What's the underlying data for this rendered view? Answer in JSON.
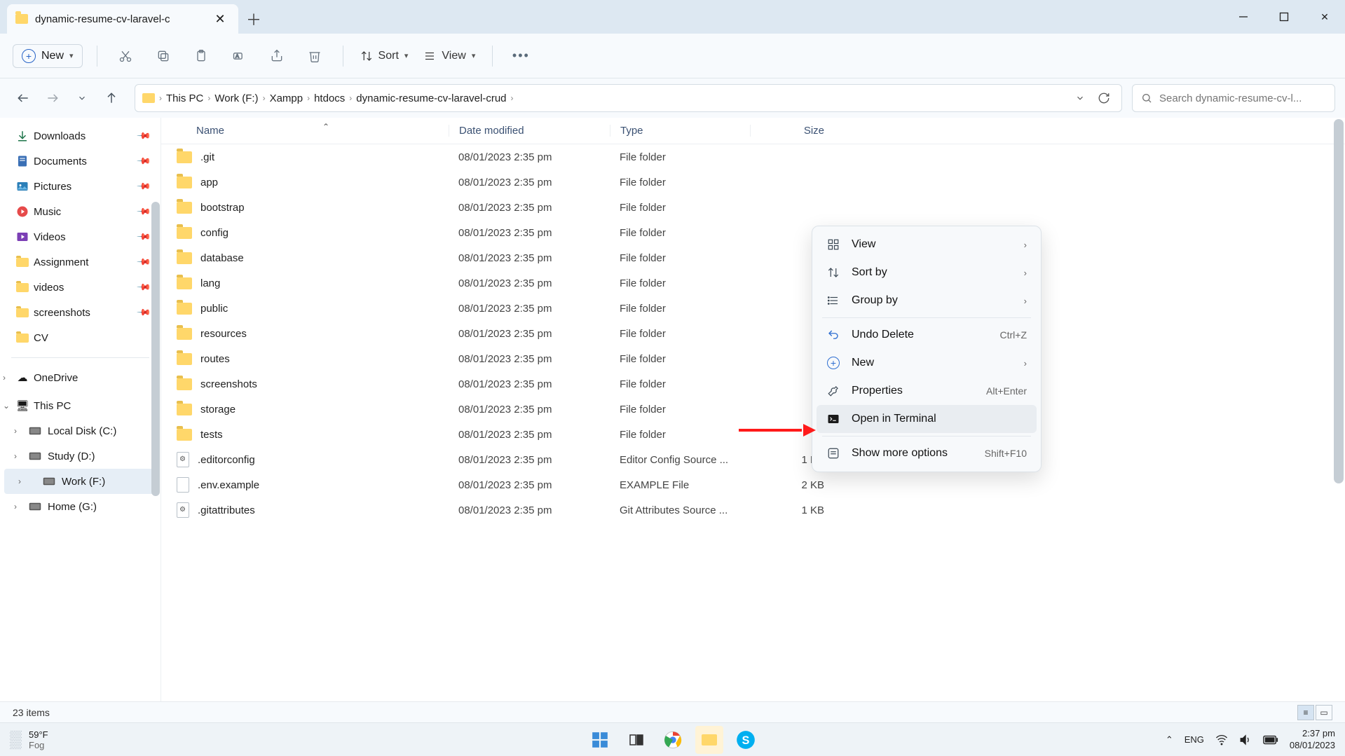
{
  "tab": {
    "title": "dynamic-resume-cv-laravel-c"
  },
  "toolbar": {
    "new_label": "New",
    "sort_label": "Sort",
    "view_label": "View"
  },
  "breadcrumb": [
    "This PC",
    "Work (F:)",
    "Xampp",
    "htdocs",
    "dynamic-resume-cv-laravel-crud"
  ],
  "search": {
    "placeholder": "Search dynamic-resume-cv-l..."
  },
  "sidebar": {
    "quick": [
      {
        "label": "Downloads",
        "icon": "download",
        "pinned": true
      },
      {
        "label": "Documents",
        "icon": "doc",
        "pinned": true
      },
      {
        "label": "Pictures",
        "icon": "pic",
        "pinned": true
      },
      {
        "label": "Music",
        "icon": "music",
        "pinned": true
      },
      {
        "label": "Videos",
        "icon": "video",
        "pinned": true
      },
      {
        "label": "Assignment",
        "icon": "folder",
        "pinned": true
      },
      {
        "label": "videos",
        "icon": "folder",
        "pinned": true
      },
      {
        "label": "screenshots",
        "icon": "folder",
        "pinned": true
      },
      {
        "label": "CV",
        "icon": "folder",
        "pinned": false
      }
    ],
    "onedrive_label": "OneDrive",
    "thispc_label": "This PC",
    "drives": [
      {
        "label": "Local Disk (C:)"
      },
      {
        "label": "Study (D:)"
      },
      {
        "label": "Work (F:)",
        "selected": true
      },
      {
        "label": "Home (G:)"
      }
    ]
  },
  "columns": {
    "name": "Name",
    "date": "Date modified",
    "type": "Type",
    "size": "Size"
  },
  "files": [
    {
      "name": ".git",
      "date": "08/01/2023 2:35 pm",
      "type": "File folder",
      "size": "",
      "kind": "folder"
    },
    {
      "name": "app",
      "date": "08/01/2023 2:35 pm",
      "type": "File folder",
      "size": "",
      "kind": "folder"
    },
    {
      "name": "bootstrap",
      "date": "08/01/2023 2:35 pm",
      "type": "File folder",
      "size": "",
      "kind": "folder"
    },
    {
      "name": "config",
      "date": "08/01/2023 2:35 pm",
      "type": "File folder",
      "size": "",
      "kind": "folder"
    },
    {
      "name": "database",
      "date": "08/01/2023 2:35 pm",
      "type": "File folder",
      "size": "",
      "kind": "folder"
    },
    {
      "name": "lang",
      "date": "08/01/2023 2:35 pm",
      "type": "File folder",
      "size": "",
      "kind": "folder"
    },
    {
      "name": "public",
      "date": "08/01/2023 2:35 pm",
      "type": "File folder",
      "size": "",
      "kind": "folder"
    },
    {
      "name": "resources",
      "date": "08/01/2023 2:35 pm",
      "type": "File folder",
      "size": "",
      "kind": "folder"
    },
    {
      "name": "routes",
      "date": "08/01/2023 2:35 pm",
      "type": "File folder",
      "size": "",
      "kind": "folder"
    },
    {
      "name": "screenshots",
      "date": "08/01/2023 2:35 pm",
      "type": "File folder",
      "size": "",
      "kind": "folder"
    },
    {
      "name": "storage",
      "date": "08/01/2023 2:35 pm",
      "type": "File folder",
      "size": "",
      "kind": "folder"
    },
    {
      "name": "tests",
      "date": "08/01/2023 2:35 pm",
      "type": "File folder",
      "size": "",
      "kind": "folder"
    },
    {
      "name": ".editorconfig",
      "date": "08/01/2023 2:35 pm",
      "type": "Editor Config Source ...",
      "size": "1 KB",
      "kind": "gear"
    },
    {
      "name": ".env.example",
      "date": "08/01/2023 2:35 pm",
      "type": "EXAMPLE File",
      "size": "2 KB",
      "kind": "file"
    },
    {
      "name": ".gitattributes",
      "date": "08/01/2023 2:35 pm",
      "type": "Git Attributes Source ...",
      "size": "1 KB",
      "kind": "gear"
    }
  ],
  "status": {
    "items": "23 items"
  },
  "context_menu": {
    "items": [
      {
        "label": "View",
        "icon": "grid",
        "arrow": true
      },
      {
        "label": "Sort by",
        "icon": "sort",
        "arrow": true
      },
      {
        "label": "Group by",
        "icon": "group",
        "arrow": true
      },
      {
        "sep": true
      },
      {
        "label": "Undo Delete",
        "icon": "undo",
        "shortcut": "Ctrl+Z"
      },
      {
        "label": "New",
        "icon": "plus",
        "arrow": true
      },
      {
        "label": "Properties",
        "icon": "wrench",
        "shortcut": "Alt+Enter"
      },
      {
        "label": "Open in Terminal",
        "icon": "terminal",
        "highlight": true
      },
      {
        "sep": true
      },
      {
        "label": "Show more options",
        "icon": "more",
        "shortcut": "Shift+F10"
      }
    ]
  },
  "taskbar": {
    "temp": "59°F",
    "cond": "Fog",
    "lang": "ENG",
    "time": "2:37 pm",
    "date": "08/01/2023"
  }
}
